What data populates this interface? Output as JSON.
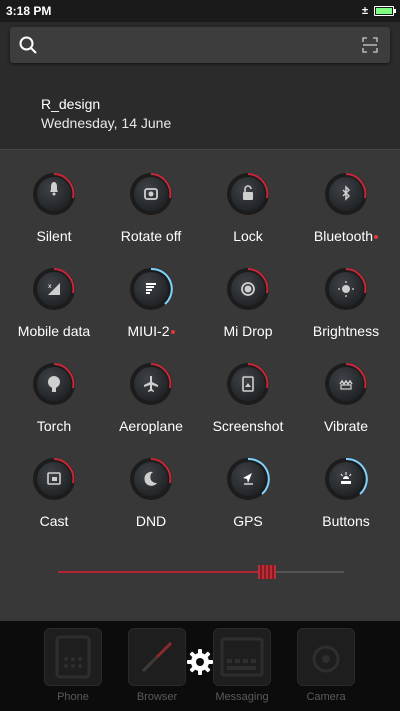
{
  "status_bar": {
    "time": "3:18 PM",
    "battery_level": 1.0,
    "battery_color": "#7fff7f"
  },
  "search": {
    "placeholder": ""
  },
  "user": {
    "name": "R_design",
    "date": "Wednesday, 14 June"
  },
  "accent": {
    "on": "#7fd4ff",
    "off": "#c8283a"
  },
  "toggles": [
    {
      "label": "Silent",
      "icon": "bell-icon",
      "state": "off"
    },
    {
      "label": "Rotate off",
      "icon": "rotate-icon",
      "state": "off"
    },
    {
      "label": "Lock",
      "icon": "lock-icon",
      "state": "off"
    },
    {
      "label": "Bluetooth",
      "icon": "bluetooth-icon",
      "state": "off",
      "badge": true
    },
    {
      "label": "Mobile data",
      "icon": "signal-icon",
      "state": "off"
    },
    {
      "label": "MIUI-2",
      "icon": "wifi-icon",
      "state": "on",
      "badge": true
    },
    {
      "label": "Mi Drop",
      "icon": "drop-icon",
      "state": "off"
    },
    {
      "label": "Brightness",
      "icon": "sun-icon",
      "state": "off"
    },
    {
      "label": "Torch",
      "icon": "torch-icon",
      "state": "off"
    },
    {
      "label": "Aeroplane",
      "icon": "plane-icon",
      "state": "off"
    },
    {
      "label": "Screenshot",
      "icon": "screenshot-icon",
      "state": "off"
    },
    {
      "label": "Vibrate",
      "icon": "vibrate-icon",
      "state": "off"
    },
    {
      "label": "Cast",
      "icon": "cast-icon",
      "state": "off"
    },
    {
      "label": "DND",
      "icon": "moon-icon",
      "state": "off"
    },
    {
      "label": "GPS",
      "icon": "location-icon",
      "state": "on"
    },
    {
      "label": "Buttons",
      "icon": "buttons-icon",
      "state": "on"
    }
  ],
  "brightness": {
    "level": 0.73
  },
  "dock": {
    "apps": [
      {
        "label": "Phone",
        "icon": "phone-icon"
      },
      {
        "label": "Browser",
        "icon": "compass-icon"
      },
      {
        "label": "Messaging",
        "icon": "keyboard-icon"
      },
      {
        "label": "Camera",
        "icon": "camera-icon"
      }
    ],
    "settings_icon": "gear-icon"
  }
}
